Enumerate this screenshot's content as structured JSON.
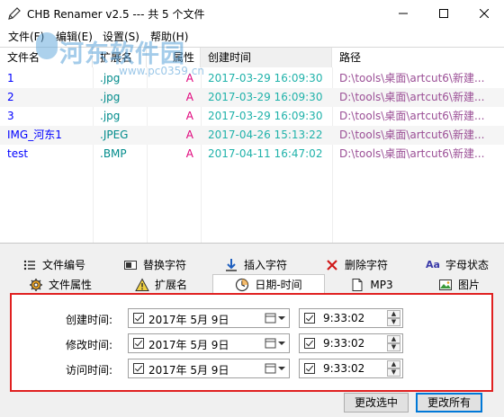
{
  "window": {
    "title": "CHB Renamer v2.5 --- 共 5 个文件"
  },
  "menu": [
    {
      "label": "文件(F)"
    },
    {
      "label": "编辑(E)"
    },
    {
      "label": "设置(S)"
    },
    {
      "label": "帮助(H)"
    }
  ],
  "watermark": {
    "text": "河东软件园",
    "url": "www.pc0359.cn"
  },
  "filelist": {
    "columns": [
      "文件名",
      "扩展名",
      "属性",
      "创建时间",
      "路径"
    ],
    "rows": [
      {
        "name": "1",
        "ext": ".jpg",
        "attr": "A",
        "ctime": "2017-03-29 16:09:30",
        "path": "D:\\tools\\桌面\\artcut6\\新建..."
      },
      {
        "name": "2",
        "ext": ".jpg",
        "attr": "A",
        "ctime": "2017-03-29 16:09:30",
        "path": "D:\\tools\\桌面\\artcut6\\新建..."
      },
      {
        "name": "3",
        "ext": ".jpg",
        "attr": "A",
        "ctime": "2017-03-29 16:09:30",
        "path": "D:\\tools\\桌面\\artcut6\\新建..."
      },
      {
        "name": "IMG_河东1",
        "ext": ".JPEG",
        "attr": "A",
        "ctime": "2017-04-26 15:13:22",
        "path": "D:\\tools\\桌面\\artcut6\\新建..."
      },
      {
        "name": "test",
        "ext": ".BMP",
        "attr": "A",
        "ctime": "2017-04-11 16:47:02",
        "path": "D:\\tools\\桌面\\artcut6\\新建..."
      }
    ]
  },
  "tabs_top": [
    {
      "label": "文件编号",
      "icon": "list-numbered-icon"
    },
    {
      "label": "替换字符",
      "icon": "replace-icon"
    },
    {
      "label": "插入字符",
      "icon": "insert-icon"
    },
    {
      "label": "删除字符",
      "icon": "delete-x-icon"
    },
    {
      "label": "字母状态",
      "icon": "letter-case-icon",
      "icon_text": "Aa"
    }
  ],
  "tabs_bottom": [
    {
      "label": "文件属性",
      "icon": "gear-icon"
    },
    {
      "label": "扩展名",
      "icon": "warning-icon"
    },
    {
      "label": "日期-时间",
      "icon": "clock-icon",
      "active": true
    },
    {
      "label": "MP3",
      "icon": "document-icon"
    },
    {
      "label": "图片",
      "icon": "image-icon"
    }
  ],
  "datetime": {
    "rows": [
      {
        "label": "创建时间:",
        "date": "2017年  5月  9日",
        "time": "9:33:02"
      },
      {
        "label": "修改时间:",
        "date": "2017年  5月  9日",
        "time": "9:33:02"
      },
      {
        "label": "访问时间:",
        "date": "2017年  5月  9日",
        "time": "9:33:02"
      }
    ]
  },
  "buttons": {
    "apply_selected": "更改选中",
    "apply_all": "更改所有"
  },
  "colors": {
    "highlight_border": "#e02020",
    "name": "#0000ff",
    "ext": "#008b8b",
    "attr": "#e0007a",
    "ctime": "#20b2aa",
    "path": "#9b4f96"
  }
}
